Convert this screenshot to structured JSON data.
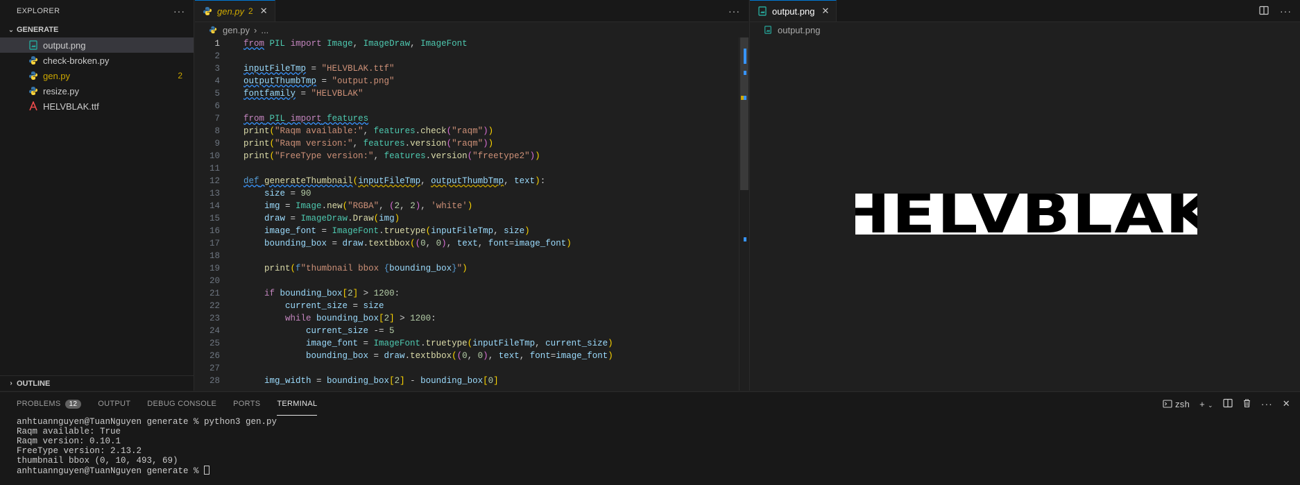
{
  "sidebar": {
    "title": "EXPLORER",
    "folder": "GENERATE",
    "files": [
      {
        "name": "output.png",
        "icon": "image-file-icon",
        "selected": true
      },
      {
        "name": "check-broken.py",
        "icon": "python-file-icon"
      },
      {
        "name": "gen.py",
        "icon": "python-file-icon",
        "badge": "2",
        "warn": true
      },
      {
        "name": "resize.py",
        "icon": "python-file-icon"
      },
      {
        "name": "HELVBLAK.ttf",
        "icon": "font-file-icon"
      }
    ],
    "outline": "OUTLINE"
  },
  "editor1": {
    "tab": {
      "name": "gen.py",
      "count": "2"
    },
    "breadcrumb": {
      "file": "gen.py",
      "rest": "..."
    },
    "lines": [
      "1",
      "2",
      "3",
      "4",
      "5",
      "6",
      "7",
      "8",
      "9",
      "10",
      "11",
      "12",
      "13",
      "14",
      "15",
      "16",
      "17",
      "18",
      "19",
      "20",
      "21",
      "22",
      "23",
      "24",
      "25",
      "26",
      "27",
      "28"
    ]
  },
  "editor2": {
    "tab": {
      "name": "output.png"
    },
    "breadcrumb": "output.png",
    "preview_text": "HELVBLAK"
  },
  "panel": {
    "tabs": [
      "PROBLEMS",
      "OUTPUT",
      "DEBUG CONSOLE",
      "PORTS",
      "TERMINAL"
    ],
    "problems_count": "12",
    "shell": "zsh",
    "terminal": [
      "anhtuannguyen@TuanNguyen generate % python3 gen.py",
      "Raqm available: True",
      "Raqm version: 0.10.1",
      "FreeType version: 2.13.2",
      "thumbnail bbox (0, 10, 493, 69)",
      "anhtuannguyen@TuanNguyen generate % "
    ]
  },
  "colors": {
    "accent": "#0078d4",
    "warning": "#cca700",
    "background": "#1f1f1f"
  }
}
